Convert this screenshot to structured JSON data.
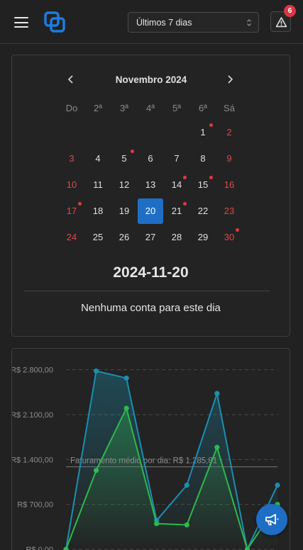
{
  "topbar": {
    "menu_icon": "hamburger-icon",
    "logo_icon": "app-logo-icon",
    "period_select": {
      "value": "Últimos 7 dias"
    },
    "alerts": {
      "icon": "warning-triangle-icon",
      "count": "6"
    }
  },
  "calendar": {
    "month_title": "Novembro 2024",
    "prev_icon": "chevron-left-icon",
    "next_icon": "chevron-right-icon",
    "weekdays": [
      "Do",
      "2ª",
      "3ª",
      "4ª",
      "5ª",
      "6ª",
      "Sá"
    ],
    "weeks": [
      [
        "",
        "",
        "",
        "",
        "",
        "1",
        "2"
      ],
      [
        "3",
        "4",
        "5",
        "6",
        "7",
        "8",
        "9"
      ],
      [
        "10",
        "11",
        "12",
        "13",
        "14",
        "15",
        "16"
      ],
      [
        "17",
        "18",
        "19",
        "20",
        "21",
        "22",
        "23"
      ],
      [
        "24",
        "25",
        "26",
        "27",
        "28",
        "29",
        "30"
      ]
    ],
    "days_with_events": [
      "1",
      "5",
      "14",
      "15",
      "17",
      "21",
      "30"
    ],
    "selected_day": "20",
    "selected_date": "2024-11-20",
    "empty_message": "Nenhuma conta para este dia",
    "weekend_color": "#e04848",
    "selected_color": "#1f6ec6",
    "event_dot_color": "#e03a3a"
  },
  "chart_data": {
    "type": "area",
    "y_ticks": [
      "R$ 0,00",
      "R$ 700,00",
      "R$ 1.400,00",
      "R$ 2.100,00",
      "R$ 2.800,00"
    ],
    "ylim": [
      0,
      2940
    ],
    "series": [
      {
        "values": [
          0,
          2780,
          2670,
          450,
          1000,
          2430,
          0,
          1000
        ],
        "color": "#1a8fb0"
      },
      {
        "values": [
          0,
          1230,
          2200,
          400,
          380,
          1590,
          0,
          700
        ],
        "color": "#2fb84d"
      }
    ],
    "average_line": {
      "label": "Faturamento médio por dia: R$ 1.285,81",
      "value": 1285.81
    }
  },
  "fab": {
    "icon": "megaphone-icon"
  }
}
